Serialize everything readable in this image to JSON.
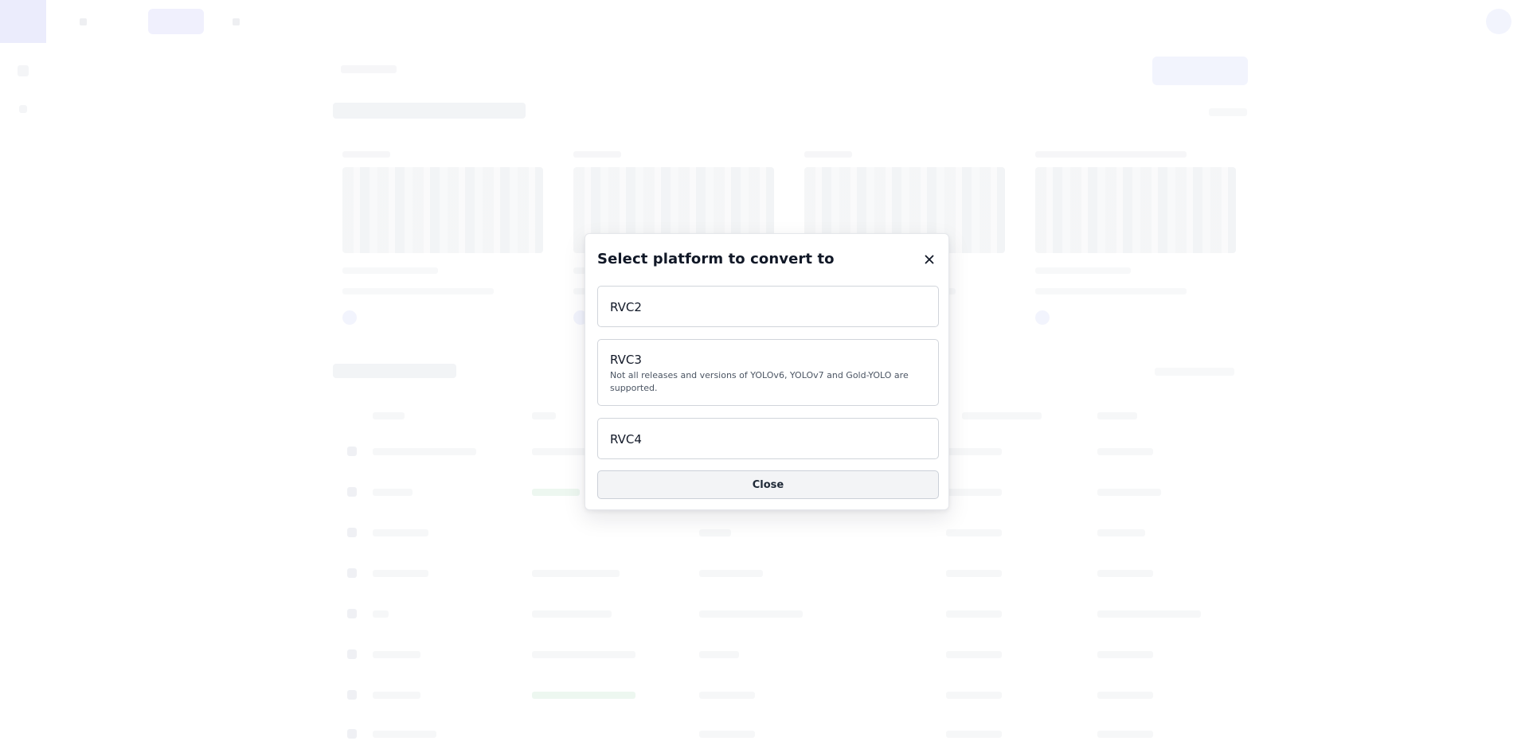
{
  "modal": {
    "title": "Select platform to convert to",
    "close_icon": "close-icon",
    "options": [
      {
        "label": "RVC2",
        "description": ""
      },
      {
        "label": "RVC3",
        "description": "Not all releases and versions of YOLOv6, YOLOv7 and Gold-YOLO are supported."
      },
      {
        "label": "RVC4",
        "description": ""
      }
    ],
    "close_button_label": "Close"
  },
  "colors": {
    "accent_faded": "#e8e9fc",
    "overlay": "#ffffff",
    "text_primary": "#111827",
    "border": "#d1d5db"
  }
}
